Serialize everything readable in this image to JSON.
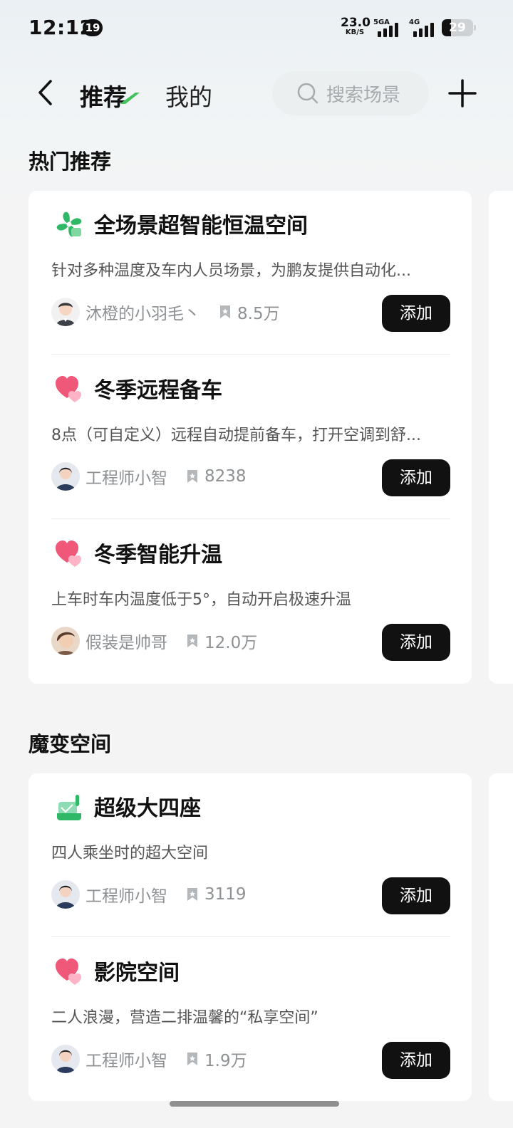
{
  "status_bar": {
    "time": "12:12",
    "notification_count": "19",
    "net_speed_value": "23.0",
    "net_speed_unit": "KB/S",
    "signal1_tag": "5GA",
    "signal2_tag": "4G",
    "battery_level": "29"
  },
  "nav": {
    "tab_recommend": "推荐",
    "tab_mine": "我的",
    "search_placeholder": "搜索场景",
    "accent_color": "#3fc35a"
  },
  "sections": [
    {
      "title": "热门推荐",
      "items": [
        {
          "icon": "fan-icon",
          "title": "全场景超智能恒温空间",
          "desc": "针对多种温度及车内人员场景，为鹏友提供自动化...",
          "author": "沐橙的小羽毛丶",
          "favorites": "8.5万",
          "button": "添加"
        },
        {
          "icon": "heart-icon",
          "title": "冬季远程备车",
          "desc": "8点（可自定义）远程自动提前备车，打开空调到舒...",
          "author": "工程师小智",
          "favorites": "8238",
          "button": "添加"
        },
        {
          "icon": "heart-icon",
          "title": "冬季智能升温",
          "desc": "上车时车内温度低于5°，自动开启极速升温",
          "author": "假装是帅哥",
          "favorites": "12.0万",
          "button": "添加"
        }
      ]
    },
    {
      "title": "魔变空间",
      "items": [
        {
          "icon": "seat-icon",
          "title": "超级大四座",
          "desc": "四人乘坐时的超大空间",
          "author": "工程师小智",
          "favorites": "3119",
          "button": "添加"
        },
        {
          "icon": "heart-icon",
          "title": "影院空间",
          "desc": "二人浪漫，营造二排温馨的“私享空间”",
          "author": "工程师小智",
          "favorites": "1.9万",
          "button": "添加"
        }
      ]
    }
  ]
}
